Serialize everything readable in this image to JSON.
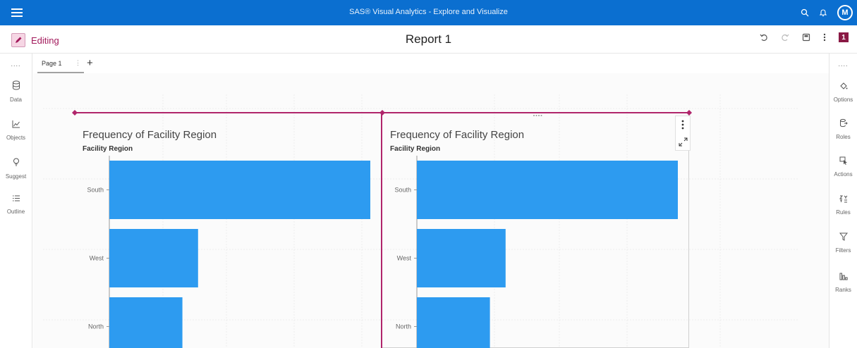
{
  "app": {
    "title": "SAS® Visual Analytics - Explore and Visualize",
    "user_initial": "M",
    "accent": "#0b6fd0"
  },
  "report": {
    "mode_label": "Editing",
    "title": "Report 1",
    "page_count_badge": "1"
  },
  "tabs": [
    {
      "label": "Page 1",
      "active": true
    }
  ],
  "left_rail": {
    "dots": "....",
    "items": [
      {
        "label": "Data",
        "icon": "database-icon"
      },
      {
        "label": "Objects",
        "icon": "line-chart-icon"
      },
      {
        "label": "Suggest",
        "icon": "lightbulb-icon"
      },
      {
        "label": "Outline",
        "icon": "list-icon"
      }
    ]
  },
  "right_rail": {
    "dots": "....",
    "items": [
      {
        "label": "Options",
        "icon": "paint-icon"
      },
      {
        "label": "Roles",
        "icon": "roles-icon"
      },
      {
        "label": "Actions",
        "icon": "cursor-icon"
      },
      {
        "label": "Rules",
        "icon": "rules-icon"
      },
      {
        "label": "Filters",
        "icon": "filter-icon"
      },
      {
        "label": "Ranks",
        "icon": "ranks-icon"
      }
    ]
  },
  "charts": [
    {
      "title": "Frequency of Facility Region",
      "axis_label": "Facility Region"
    },
    {
      "title": "Frequency of Facility Region",
      "axis_label": "Facility Region"
    }
  ],
  "chart_data": [
    {
      "type": "bar",
      "orientation": "horizontal",
      "title": "Frequency of Facility Region",
      "ylabel": "Facility Region",
      "categories": [
        "South",
        "West",
        "North"
      ],
      "values": [
        100,
        34,
        28
      ],
      "bar_color": "#2d9bf0",
      "grid": true
    },
    {
      "type": "bar",
      "orientation": "horizontal",
      "title": "Frequency of Facility Region",
      "ylabel": "Facility Region",
      "categories": [
        "South",
        "West",
        "North"
      ],
      "values": [
        100,
        34,
        28
      ],
      "bar_color": "#2d9bf0",
      "grid": true
    }
  ]
}
